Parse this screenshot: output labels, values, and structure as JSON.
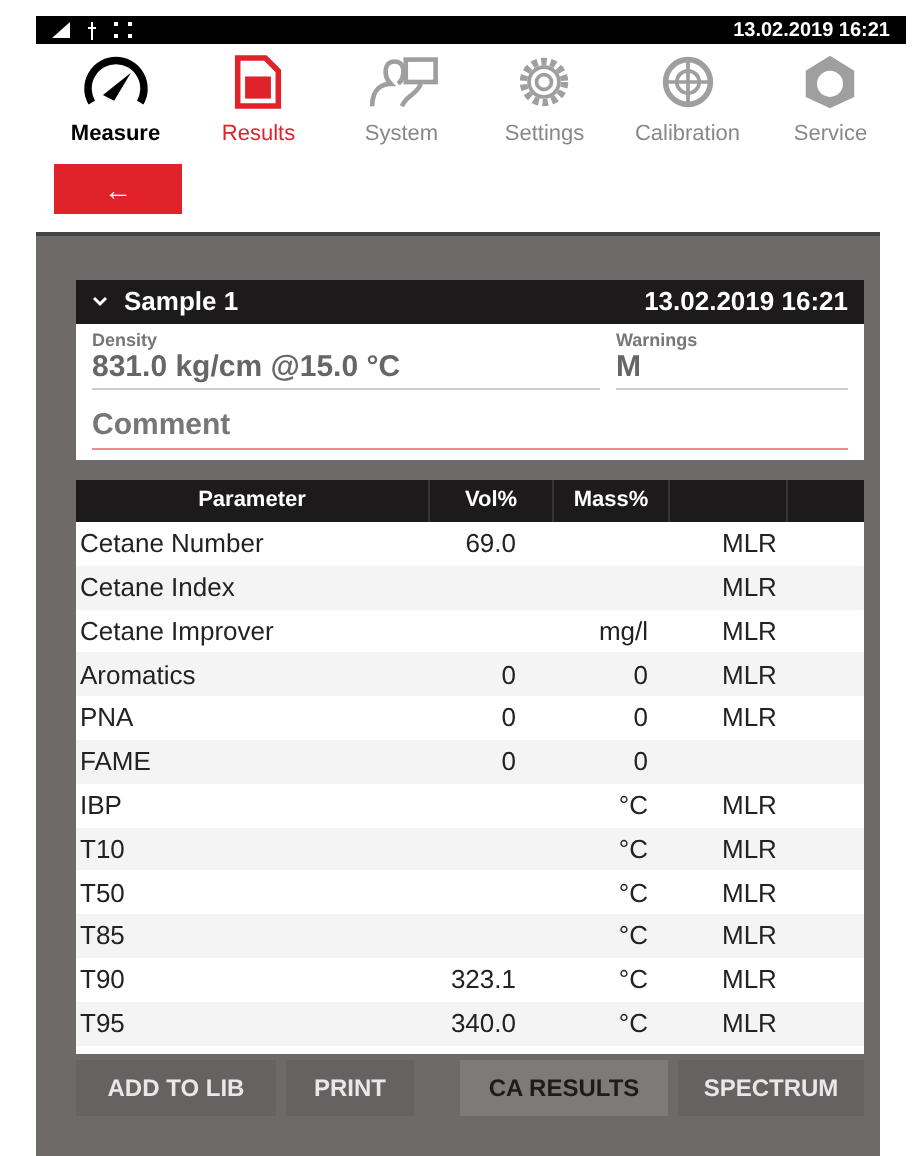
{
  "status_bar": {
    "time": "13.02.2019 16:21"
  },
  "nav": [
    {
      "label": "Measure",
      "kind": "gauge",
      "selected": false,
      "disabled": false
    },
    {
      "label": "Results",
      "kind": "document",
      "selected": true,
      "disabled": false
    },
    {
      "label": "System",
      "kind": "system",
      "selected": false,
      "disabled": true
    },
    {
      "label": "Settings",
      "kind": "gear",
      "selected": false,
      "disabled": true
    },
    {
      "label": "Calibration",
      "kind": "crosshair",
      "selected": false,
      "disabled": true
    },
    {
      "label": "Service",
      "kind": "hexnut",
      "selected": false,
      "disabled": true
    }
  ],
  "back_button": {
    "label": "←"
  },
  "sample": {
    "title": "Sample 1",
    "expanded": true,
    "time": "13.02.2019 16:21",
    "density": {
      "label": "Density",
      "value": "831.0 kg/cm @15.0 °C"
    },
    "warnings": {
      "label": "Warnings",
      "value": "M"
    },
    "comment": {
      "placeholder": "Comment"
    }
  },
  "table": {
    "columns": [
      "Parameter",
      "Vol%",
      "Mass%"
    ],
    "rows": [
      [
        "Cetane Number",
        "69.0",
        "",
        "MLR"
      ],
      [
        "Cetane Index",
        "",
        "",
        "MLR"
      ],
      [
        "Cetane Improver",
        "",
        "mg/l",
        "MLR"
      ],
      [
        "Aromatics",
        "0",
        "0",
        "MLR"
      ],
      [
        "PNA",
        "0",
        "0",
        "MLR"
      ],
      [
        "FAME",
        "0",
        "0",
        ""
      ],
      [
        "IBP",
        "",
        "°C",
        "MLR"
      ],
      [
        "T10",
        "",
        "°C",
        "MLR"
      ],
      [
        "T50",
        "",
        "°C",
        "MLR"
      ],
      [
        "T85",
        "",
        "°C",
        "MLR"
      ],
      [
        "T90",
        "323.1",
        "°C",
        "MLR"
      ],
      [
        "T95",
        "340.0",
        "°C",
        "MLR"
      ]
    ]
  },
  "buttons": [
    {
      "label": "ADD TO LIB",
      "selected": false
    },
    {
      "label": "PRINT",
      "selected": false
    },
    {
      "label": "CA RESULTS",
      "selected": true
    },
    {
      "label": "SPECTRUM",
      "selected": false
    }
  ]
}
